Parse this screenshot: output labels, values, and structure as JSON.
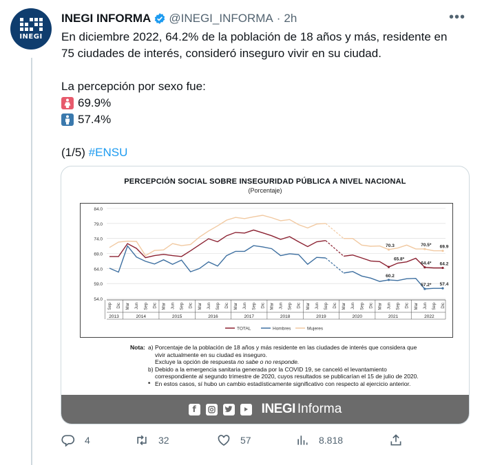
{
  "tweet": {
    "author_name": "INEGI INFORMA",
    "handle": "@INEGI_INFORMA",
    "separator": "·",
    "time": "2h",
    "avatar_text": "INEGI",
    "more_icon": "more-icon",
    "text_line1": "En diciembre 2022, 64.2% de la población de 18 años y más, residente en",
    "text_line2": "75 ciudades de interés, consideró inseguro vivir en su ciudad.",
    "text_line3": "La percepción por sexo fue:",
    "female_value": "69.9%",
    "male_value": "57.4%",
    "thread_count": "(1/5)",
    "hashtag": "#ENSU",
    "colors": {
      "female_emoji": "#e75a6c",
      "male_emoji": "#3a79ad",
      "link": "#1d9bf0"
    }
  },
  "card": {
    "footer_brand_bold": "INEGI",
    "footer_brand": "Informa",
    "footer_icons": [
      "facebook-icon",
      "instagram-icon",
      "twitter-icon",
      "youtube-icon"
    ],
    "notes": {
      "label": "Nota:",
      "a_label": "a)",
      "a_line1": "Porcentaje de la población de 18 años y más residente en las ciudades de interés que considera que",
      "a_line2": "vivir actualmente en su ciudad es inseguro.",
      "a_line3_pre": "Excluye la opción de respuesta ",
      "a_line3_em": "no sabe o no responde.",
      "b_label": "b)",
      "b_line1": "Debido a la emergencia sanitaria generada por la COVID 19, se canceló el levantamiento",
      "b_line2": "correspondiente al segundo trimestre de 2020, cuyos resultados se publicarían el 15 de julio de 2020.",
      "star_label": "*",
      "star_line": "En estos casos, sí hubo un cambio estadísticamente significativo con respecto al ejercicio anterior."
    }
  },
  "chart_data": {
    "type": "line",
    "title": "PERCEPCIÓN SOCIAL SOBRE INSEGURIDAD PÚBLICA A NIVEL NACIONAL",
    "subtitle": "(Porcentaje)",
    "ylim": [
      54.0,
      84.0
    ],
    "yticks": [
      "84.0",
      "79.0",
      "74.0",
      "69.0",
      "64.0",
      "59.0",
      "54.0"
    ],
    "quarters": [
      "Sep",
      "Dic",
      "Mar",
      "Jun",
      "Sep",
      "Dic",
      "Mar",
      "Jun",
      "Sep",
      "Dic",
      "Mar",
      "Jun",
      "Sep",
      "Dic",
      "Mar",
      "Jun",
      "Sep",
      "Dic",
      "Mar",
      "Jun",
      "Sep",
      "Dic",
      "Mar",
      "Jun",
      "Sep",
      "Dic",
      "Mar",
      "Jun",
      "Sep",
      "Dic",
      "Mar",
      "Jun",
      "Sep",
      "Dic",
      "Mar",
      "Jun",
      "Sep",
      "Dic"
    ],
    "years": [
      "2013",
      "2014",
      "2015",
      "2016",
      "2017",
      "2018",
      "2019",
      "2020",
      "2021",
      "2022"
    ],
    "year_spans": [
      2,
      4,
      4,
      4,
      4,
      4,
      4,
      4,
      4,
      4
    ],
    "legend": [
      "TOTAL",
      "Hombres",
      "Mujeres"
    ],
    "legend_position": "bottom",
    "gap_index": 29,
    "series": [
      {
        "name": "TOTAL",
        "color": "#8b2131",
        "values": [
          68.0,
          68.0,
          72.3,
          70.7,
          67.6,
          68.3,
          68.7,
          68.3,
          68.0,
          69.9,
          71.9,
          73.9,
          72.9,
          74.9,
          76.0,
          75.8,
          76.8,
          75.9,
          74.9,
          73.7,
          74.6,
          72.9,
          71.3,
          72.9,
          73.3,
          null,
          68.1,
          68.5,
          67.5,
          66.5,
          66.3,
          64.5,
          65.8,
          66.2,
          67.4,
          64.4,
          64.2,
          64.2
        ]
      },
      {
        "name": "Hombres",
        "color": "#3d6fa0",
        "values": [
          64.1,
          62.8,
          71.5,
          67.8,
          66.4,
          65.5,
          66.9,
          65.4,
          66.8,
          62.9,
          64.0,
          66.2,
          64.8,
          68.3,
          69.7,
          69.7,
          71.6,
          71.2,
          70.6,
          68.3,
          68.9,
          68.6,
          65.4,
          67.7,
          67.5,
          null,
          62.5,
          63.0,
          61.5,
          60.8,
          59.7,
          60.2,
          60.0,
          60.6,
          60.7,
          57.2,
          57.4,
          57.4
        ]
      },
      {
        "name": "Mujeres",
        "color": "#f1c9a1",
        "values": [
          71.0,
          72.8,
          73.1,
          73.0,
          68.3,
          70.0,
          70.2,
          72.3,
          71.6,
          72.0,
          74.5,
          76.5,
          78.2,
          80.1,
          81.0,
          80.6,
          81.2,
          81.7,
          80.9,
          79.9,
          80.3,
          78.6,
          77.5,
          78.8,
          79.0,
          null,
          74.0,
          74.0,
          71.8,
          71.4,
          71.5,
          70.3,
          70.8,
          71.8,
          70.5,
          70.5,
          69.9,
          69.9
        ]
      }
    ],
    "data_labels": [
      {
        "text": "70.3",
        "series": "Mujeres",
        "index": 31
      },
      {
        "text": "69.9",
        "series": "Mujeres",
        "index": 37
      },
      {
        "text": "70.5*",
        "series": "Mujeres",
        "index": 35
      },
      {
        "text": "65.8*",
        "series": "TOTAL",
        "index": 32
      },
      {
        "text": "64.2",
        "series": "TOTAL",
        "index": 37
      },
      {
        "text": "64.4*",
        "series": "TOTAL",
        "index": 35
      },
      {
        "text": "60.2",
        "series": "Hombres",
        "index": 31
      },
      {
        "text": "57.2*",
        "series": "Hombres",
        "index": 35
      },
      {
        "text": "57.4",
        "series": "Hombres",
        "index": 37
      }
    ]
  },
  "actions": {
    "reply_count": "4",
    "retweet_count": "32",
    "like_count": "57",
    "views_count": "8.818",
    "icons": [
      "reply-icon",
      "retweet-icon",
      "like-icon",
      "views-icon",
      "share-icon"
    ]
  }
}
